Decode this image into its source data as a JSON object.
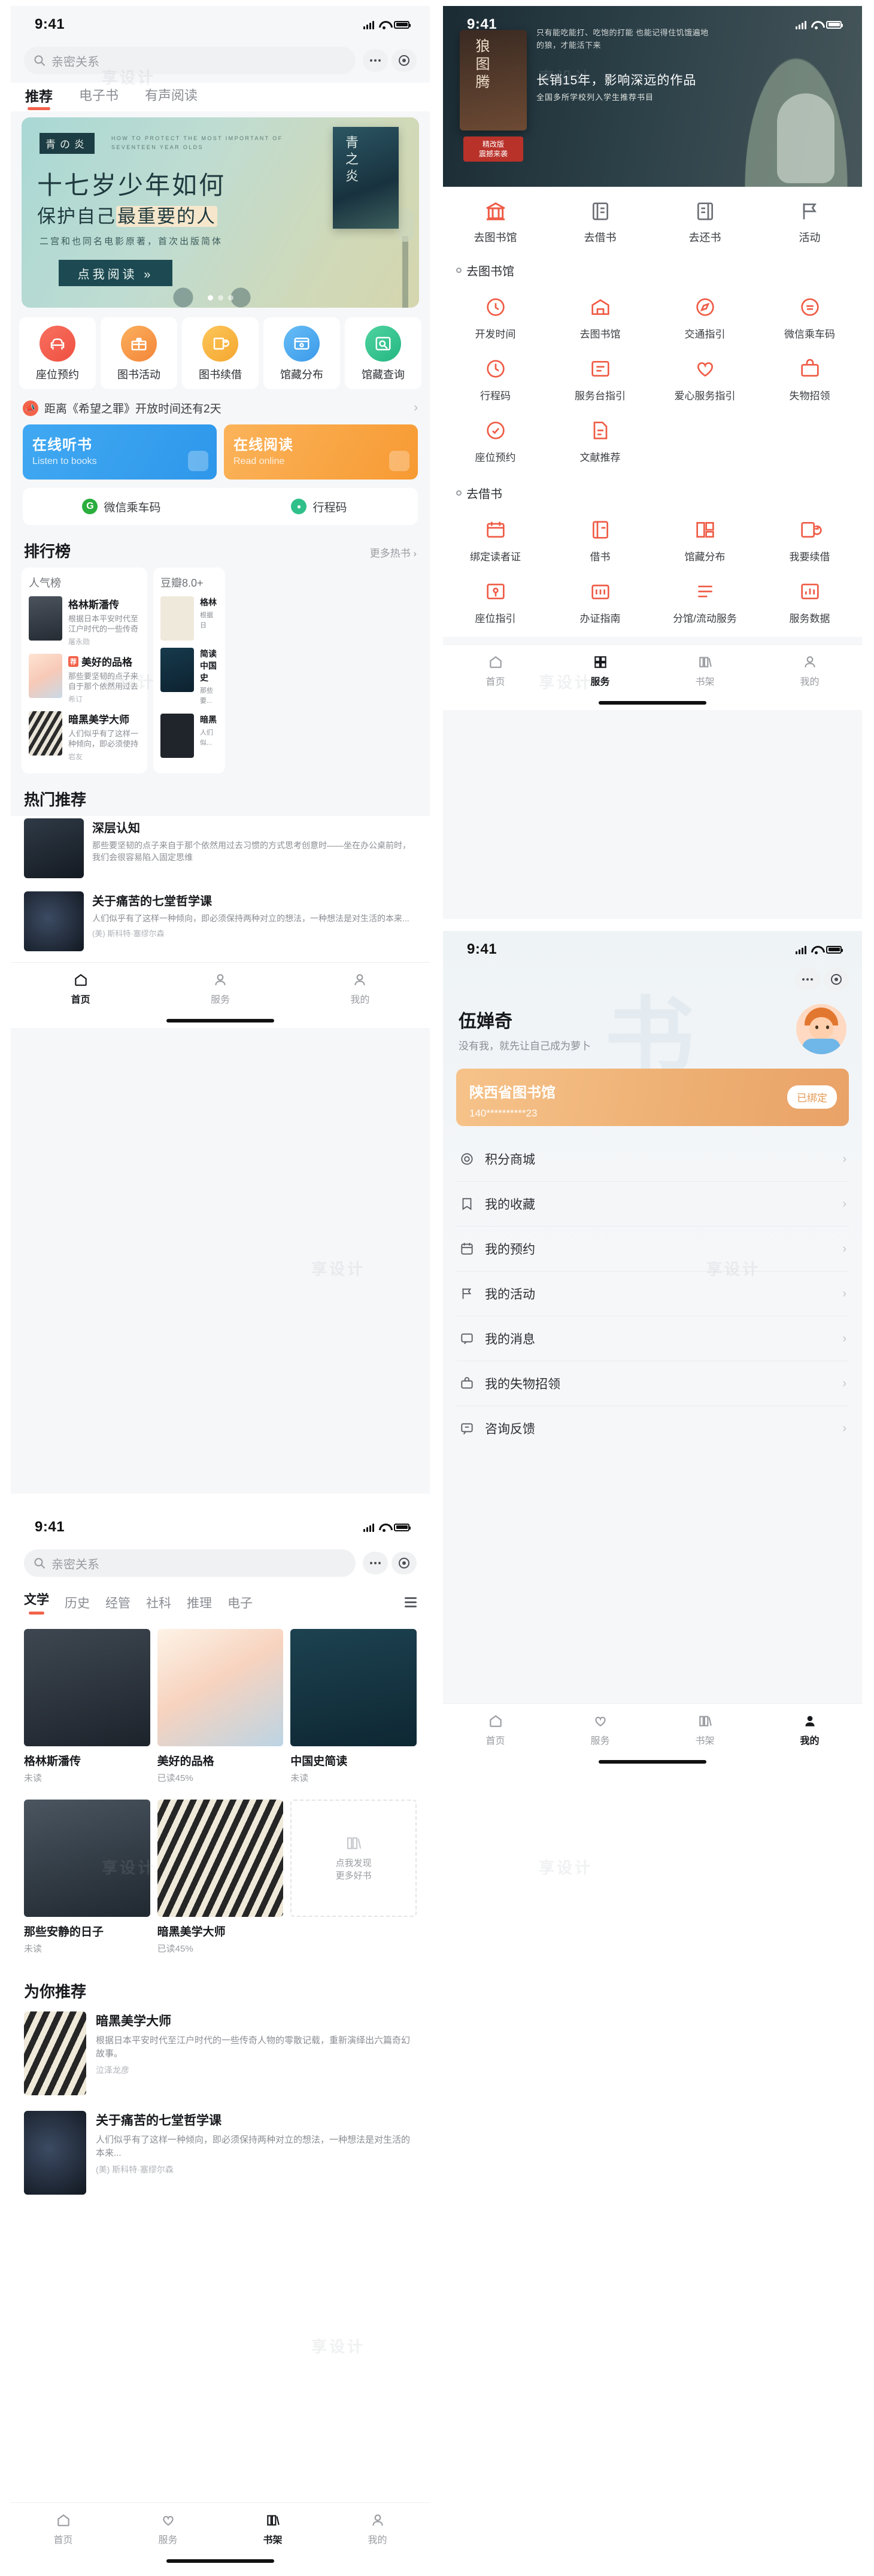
{
  "status_bar": {
    "time": "9:41"
  },
  "screen_home": {
    "search": {
      "placeholder": "亲密关系",
      "icon": "search-icon"
    },
    "capsule": {
      "more_icon": "more-dots-icon",
      "target_icon": "target-icon"
    },
    "tabs": [
      {
        "label": "推荐",
        "active": true
      },
      {
        "label": "电子书",
        "active": false
      },
      {
        "label": "有声阅读",
        "active": false
      }
    ],
    "banner": {
      "badge": "青の炎",
      "english": "HOW TO PROTECT THE MOST IMPORTANT OF SEVENTEEN YEAR OLDS",
      "line1": "十七岁少年如何",
      "line2_a": "保护自己",
      "line2_b": "最重要的人",
      "sub": "二宫和也同名电影原著，首次出版简体",
      "cta": "点我阅读 »",
      "cover_title": "青之炎",
      "dots": 3,
      "active_dot": 0
    },
    "quick_actions": [
      {
        "label": "座位预约",
        "icon": "sofa-icon",
        "color": "#f3614d"
      },
      {
        "label": "图书活动",
        "icon": "gift-icon",
        "color": "#f79646"
      },
      {
        "label": "图书续借",
        "icon": "book-renew-icon",
        "color": "#f6b33f"
      },
      {
        "label": "馆藏分布",
        "icon": "map-pin-window-icon",
        "color": "#46a6f0"
      },
      {
        "label": "馆藏查询",
        "icon": "search-box-icon",
        "color": "#2fc08a"
      }
    ],
    "notice": {
      "text": "距离《希望之罪》开放时间还有2天",
      "icon": "megaphone-icon",
      "arrow": "›"
    },
    "promos": [
      {
        "title": "在线听书",
        "subtitle": "Listen to books",
        "color": "#3ca3f0",
        "icon": "headphone-icon"
      },
      {
        "title": "在线阅读",
        "subtitle": "Read online",
        "color": "#f9a23c",
        "icon": "book-open-icon"
      }
    ],
    "wechat_row": [
      {
        "label": "微信乘车码",
        "badge": "G",
        "color": "#2aae3d"
      },
      {
        "label": "行程码",
        "badge": "●",
        "color": "#2fc08a"
      }
    ],
    "rank_section": {
      "title": "排行榜",
      "more": "更多热书 ›"
    },
    "rank_main": {
      "title": "人气榜",
      "items": [
        {
          "name": "格林斯潘传",
          "tag": "",
          "desc": "根据日本平安时代至江户时代的一些传奇人物的零...",
          "author": "屠永勋"
        },
        {
          "name": "美好的品格",
          "tag": "荐",
          "desc": "那些要坚韧的点子来自于那个依然用过去习惯的方式...",
          "author": "希订"
        },
        {
          "name": "暗黑美学大师",
          "tag": "",
          "desc": "人们似乎有了这样一种倾向，即必须使持两种对立的想法，一种想法是对生活的本来...",
          "author": "岩友"
        }
      ]
    },
    "rank_side": {
      "title": "豆瓣8.0+",
      "items": [
        {
          "name": "格林",
          "desc": "根据日本..."
        },
        {
          "name": "简读中国史",
          "desc": "那些要..."
        },
        {
          "name": "暗黑",
          "desc": "人们似..."
        }
      ]
    },
    "hot_section": {
      "title": "热门推荐"
    },
    "hot_items": [
      {
        "name": "深层认知",
        "desc": "那些要坚韧的点子来自于那个依然用过去习惯的方式思考创意时——坐在办公桌前时，我们会很容易陷入固定思维",
        "author": ""
      },
      {
        "name": "关于痛苦的七堂哲学课",
        "desc": "人们似乎有了这样一种倾向，即必须保持两种对立的想法，一种想法是对生活的本来...",
        "author": "(美) 斯科特·塞缪尔森"
      }
    ],
    "tabbar": [
      {
        "label": "首页",
        "icon": "home-icon",
        "active": true
      },
      {
        "label": "服务",
        "icon": "grid-service-icon",
        "active": false
      },
      {
        "label": "我的",
        "icon": "person-icon",
        "active": false
      }
    ]
  },
  "screen_service": {
    "hero": {
      "cover_title": "狼图腾",
      "paragraph": "只有能吃能打、吃饱的打能 也能记得住饥饿遍地的狼，才能活下来",
      "headline": "长销15年，影响深远的作品",
      "subline": "全国多所学校列入学生推荐书目",
      "stamp": "精改版\n震撼来袭"
    },
    "nav_tabs": [
      {
        "label": "去图书馆",
        "icon": "library-building-icon",
        "active": true
      },
      {
        "label": "去借书",
        "icon": "borrow-book-icon",
        "active": false
      },
      {
        "label": "去还书",
        "icon": "return-book-icon",
        "active": false
      },
      {
        "label": "活动",
        "icon": "flag-activity-icon",
        "active": false
      }
    ],
    "groups": [
      {
        "title": "去图书馆",
        "items": [
          {
            "label": "开发时间",
            "icon": "clock-icon"
          },
          {
            "label": "去图书馆",
            "icon": "library-icon"
          },
          {
            "label": "交通指引",
            "icon": "compass-icon"
          },
          {
            "label": "微信乘车码",
            "icon": "wechat-ride-icon"
          },
          {
            "label": "行程码",
            "icon": "travel-code-icon"
          },
          {
            "label": "服务台指引",
            "icon": "service-desk-icon"
          },
          {
            "label": "爱心服务指引",
            "icon": "heart-service-icon"
          },
          {
            "label": "失物招领",
            "icon": "lost-found-icon"
          },
          {
            "label": "座位预约",
            "icon": "seat-reserve-icon"
          },
          {
            "label": "文献推荐",
            "icon": "doc-recommend-icon"
          }
        ]
      },
      {
        "title": "去借书",
        "items": [
          {
            "label": "绑定读者证",
            "icon": "bind-card-icon"
          },
          {
            "label": "借书",
            "icon": "borrow-icon"
          },
          {
            "label": "馆藏分布",
            "icon": "collection-map-icon"
          },
          {
            "label": "我要续借",
            "icon": "renew-icon"
          },
          {
            "label": "座位指引",
            "icon": "seat-guide-icon"
          },
          {
            "label": "办证指南",
            "icon": "id-card-icon"
          },
          {
            "label": "分馆/流动服务",
            "icon": "branch-service-icon"
          },
          {
            "label": "服务数据",
            "icon": "stats-icon"
          }
        ]
      }
    ],
    "tabbar": [
      {
        "label": "首页",
        "icon": "home-icon",
        "active": false
      },
      {
        "label": "服务",
        "icon": "grid-service-icon",
        "active": true
      },
      {
        "label": "书架",
        "icon": "shelf-icon",
        "active": false
      },
      {
        "label": "我的",
        "icon": "person-icon",
        "active": false
      }
    ]
  },
  "screen_profile": {
    "user": {
      "name": "伍婵奇",
      "desc": "没有我，就先让自己成为萝卜"
    },
    "library_card": {
      "title": "陕西省图书馆",
      "number": "140**********23",
      "status": "已绑定"
    },
    "menu": [
      {
        "label": "积分商城",
        "icon": "coin-icon",
        "chevron": "›"
      },
      {
        "label": "我的收藏",
        "icon": "bookmark-icon",
        "chevron": "›"
      },
      {
        "label": "我的预约",
        "icon": "calendar-icon",
        "chevron": "›"
      },
      {
        "label": "我的活动",
        "icon": "activity-icon",
        "chevron": "›"
      },
      {
        "label": "我的消息",
        "icon": "message-icon",
        "chevron": "›"
      },
      {
        "label": "我的失物招领",
        "icon": "lost-item-icon",
        "chevron": "›"
      },
      {
        "label": "咨询反馈",
        "icon": "feedback-icon",
        "chevron": "›"
      }
    ],
    "tabbar": [
      {
        "label": "首页",
        "icon": "home-icon",
        "active": false
      },
      {
        "label": "服务",
        "icon": "grid-service-icon",
        "active": false
      },
      {
        "label": "书架",
        "icon": "shelf-icon",
        "active": false
      },
      {
        "label": "我的",
        "icon": "person-icon",
        "active": true
      }
    ]
  },
  "screen_shelf": {
    "search": {
      "placeholder": "亲密关系",
      "icon": "search-icon"
    },
    "categories": [
      {
        "label": "文学",
        "active": true
      },
      {
        "label": "历史",
        "active": false
      },
      {
        "label": "经管",
        "active": false
      },
      {
        "label": "社科",
        "active": false
      },
      {
        "label": "推理",
        "active": false
      },
      {
        "label": "电子",
        "active": false
      }
    ],
    "menu_icon": "hamburger-icon",
    "books": [
      {
        "name": "格林斯潘传",
        "status": "未读"
      },
      {
        "name": "美好的品格",
        "status": "已读45%"
      },
      {
        "name": "中国史简读",
        "status": "未读"
      },
      {
        "name": "那些安静的日子",
        "status": "未读"
      },
      {
        "name": "暗黑美学大师",
        "status": "已读45%"
      },
      {
        "name": "",
        "status": "",
        "placeholder": "点我发现\n更多好书"
      }
    ],
    "recommend_title": "为你推荐",
    "recommend": [
      {
        "name": "暗黑美学大师",
        "desc": "根据日本平安时代至江户时代的一些传奇人物的零散记载，重新演绎出六篇奇幻故事。",
        "author": "泣泽龙彦"
      },
      {
        "name": "关于痛苦的七堂哲学课",
        "desc": "人们似乎有了这样一种倾向，即必须保持两种对立的想法，一种想法是对生活的本来...",
        "author": "(美) 斯科特·塞缪尔森"
      }
    ],
    "tabbar": [
      {
        "label": "首页",
        "icon": "home-icon",
        "active": false
      },
      {
        "label": "服务",
        "icon": "grid-service-icon",
        "active": false
      },
      {
        "label": "书架",
        "icon": "shelf-icon",
        "active": true
      },
      {
        "label": "我的",
        "icon": "person-icon",
        "active": false
      }
    ]
  }
}
